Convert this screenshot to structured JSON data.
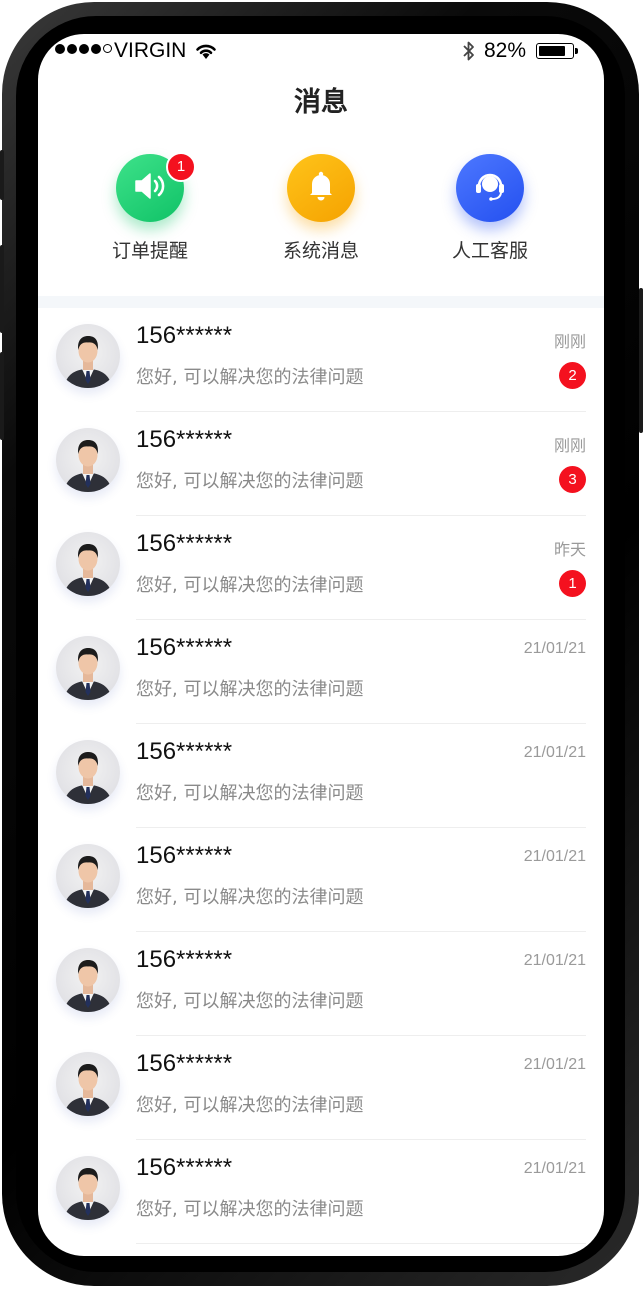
{
  "status_bar": {
    "carrier": "VIRGIN",
    "battery_text": "82%",
    "battery_level": 0.82
  },
  "header": {
    "title": "消息"
  },
  "quick_actions": [
    {
      "label": "订单提醒",
      "icon": "speaker-icon",
      "badge": "1",
      "color": "#17c96f"
    },
    {
      "label": "系统消息",
      "icon": "bell-icon",
      "badge": "",
      "color": "#f8ae00"
    },
    {
      "label": "人工客服",
      "icon": "headset-icon",
      "badge": "",
      "color": "#3360f7"
    }
  ],
  "messages": [
    {
      "name": "156******",
      "preview": "您好, 可以解决您的法律问题",
      "time": "刚刚",
      "badge": "2"
    },
    {
      "name": "156******",
      "preview": "您好, 可以解决您的法律问题",
      "time": "刚刚",
      "badge": "3"
    },
    {
      "name": "156******",
      "preview": "您好, 可以解决您的法律问题",
      "time": "昨天",
      "badge": "1"
    },
    {
      "name": "156******",
      "preview": "您好, 可以解决您的法律问题",
      "time": "21/01/21",
      "badge": ""
    },
    {
      "name": "156******",
      "preview": "您好, 可以解决您的法律问题",
      "time": "21/01/21",
      "badge": ""
    },
    {
      "name": "156******",
      "preview": "您好, 可以解决您的法律问题",
      "time": "21/01/21",
      "badge": ""
    },
    {
      "name": "156******",
      "preview": "您好, 可以解决您的法律问题",
      "time": "21/01/21",
      "badge": ""
    },
    {
      "name": "156******",
      "preview": "您好, 可以解决您的法律问题",
      "time": "21/01/21",
      "badge": ""
    },
    {
      "name": "156******",
      "preview": "您好, 可以解决您的法律问题",
      "time": "21/01/21",
      "badge": ""
    }
  ],
  "colors": {
    "badge": "#f4111f",
    "band": "#f4f7fa",
    "preview_text": "#8a8a8a",
    "time_text": "#9a9a9a"
  }
}
